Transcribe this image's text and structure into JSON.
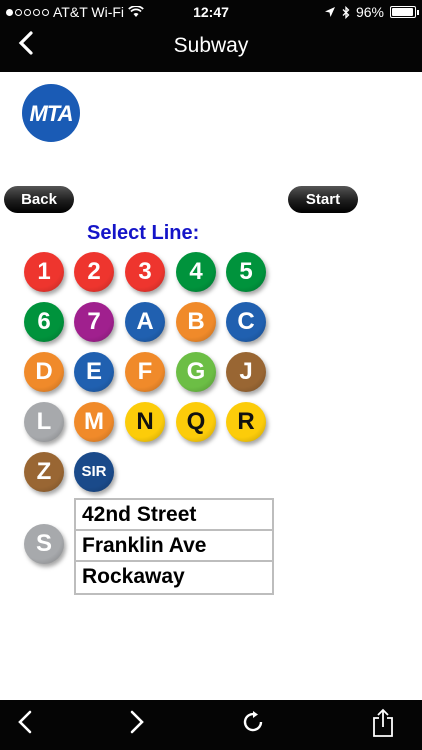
{
  "status_bar": {
    "carrier": "AT&T Wi-Fi",
    "time": "12:47",
    "battery": "96%"
  },
  "nav": {
    "title": "Subway"
  },
  "logo": {
    "text": "MTA",
    "color": "#1a5bb5"
  },
  "buttons": {
    "back_label": "Back",
    "start_label": "Start"
  },
  "select_line_label": "Select Line:",
  "lines": [
    {
      "label": "1",
      "color": "#ee352e"
    },
    {
      "label": "2",
      "color": "#ee352e"
    },
    {
      "label": "3",
      "color": "#ee352e"
    },
    {
      "label": "4",
      "color": "#00933c"
    },
    {
      "label": "5",
      "color": "#00933c"
    },
    {
      "label": "6",
      "color": "#00933c"
    },
    {
      "label": "7",
      "color": "#a0208e"
    },
    {
      "label": "A",
      "color": "#2060b0"
    },
    {
      "label": "B",
      "color": "#f08a2a"
    },
    {
      "label": "C",
      "color": "#2060b0"
    },
    {
      "label": "D",
      "color": "#f08a2a"
    },
    {
      "label": "E",
      "color": "#2060b0"
    },
    {
      "label": "F",
      "color": "#f08a2a"
    },
    {
      "label": "G",
      "color": "#6cbe45"
    },
    {
      "label": "J",
      "color": "#996633"
    },
    {
      "label": "L",
      "color": "#a7a9ac"
    },
    {
      "label": "M",
      "color": "#f08a2a"
    },
    {
      "label": "N",
      "color": "#fccc0a"
    },
    {
      "label": "Q",
      "color": "#fccc0a"
    },
    {
      "label": "R",
      "color": "#fccc0a"
    },
    {
      "label": "Z",
      "color": "#996633"
    },
    {
      "label": "SIR",
      "color": "#1a4a8a"
    },
    {
      "label": "S",
      "color": "#a7a9ac"
    }
  ],
  "shuttle_branches": [
    "42nd Street",
    "Franklin Ave",
    "Rockaway"
  ],
  "toolbar": {
    "back_icon": "chevron-left-icon",
    "forward_icon": "chevron-right-icon",
    "reload_icon": "reload-icon",
    "share_icon": "share-icon"
  }
}
